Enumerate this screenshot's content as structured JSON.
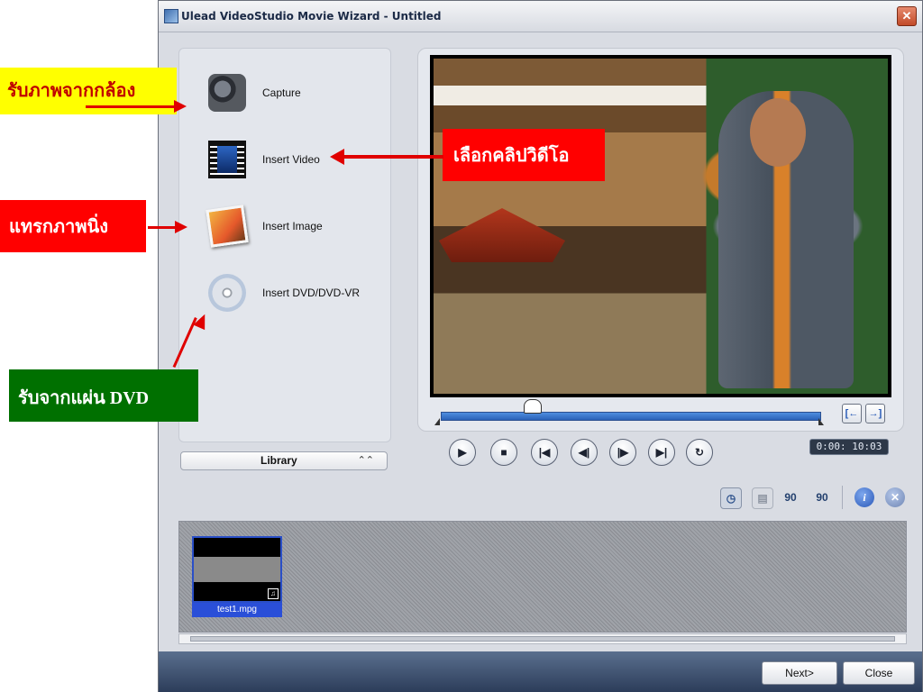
{
  "window": {
    "title": "Ulead VideoStudio Movie Wizard - Untitled"
  },
  "tools": [
    {
      "id": "capture",
      "label": "Capture",
      "icon": "camcorder-icon"
    },
    {
      "id": "insert-video",
      "label": "Insert Video",
      "icon": "film-strip-icon"
    },
    {
      "id": "insert-image",
      "label": "Insert Image",
      "icon": "photo-icon"
    },
    {
      "id": "insert-dvd",
      "label": "Insert DVD/DVD-VR",
      "icon": "dvd-disc-icon"
    }
  ],
  "library": {
    "label": "Library"
  },
  "player": {
    "timecode": "0:00: 10:03",
    "progress_fraction": 0.24,
    "trim_in_glyph": "[←",
    "trim_out_glyph": "→]",
    "buttons": [
      {
        "name": "play-button",
        "glyph": "▶"
      },
      {
        "name": "stop-button",
        "glyph": "■"
      },
      {
        "name": "go-to-start-button",
        "glyph": "|◀"
      },
      {
        "name": "previous-frame-button",
        "glyph": "◀|"
      },
      {
        "name": "next-frame-button",
        "glyph": "|▶"
      },
      {
        "name": "go-to-end-button",
        "glyph": "▶|"
      },
      {
        "name": "repeat-button",
        "glyph": "↻"
      }
    ]
  },
  "toolbar": {
    "rotate_left_glyph": "90",
    "rotate_right_glyph": "90",
    "info_glyph": "i",
    "close_glyph": "✕"
  },
  "storyboard": {
    "clips": [
      {
        "name": "test1.mpg"
      }
    ]
  },
  "footer": {
    "next_label": "Next>",
    "close_label": "Close"
  },
  "annotations": {
    "capture": "รับภาพจากกล้อง",
    "insert_video": "เลือกคลิปวิดีโอ",
    "insert_image": "แทรกภาพนิ่ง",
    "insert_dvd": "รับจากแผ่น DVD"
  },
  "colors": {
    "annotation_yellow": "#ffff00",
    "annotation_red": "#ff0000",
    "annotation_green": "#007000",
    "annotation_text_red": "#c00000",
    "arrow_red": "#e00000",
    "scrub_blue": "#2a62b8",
    "clip_label_blue": "#2a4fd8"
  }
}
